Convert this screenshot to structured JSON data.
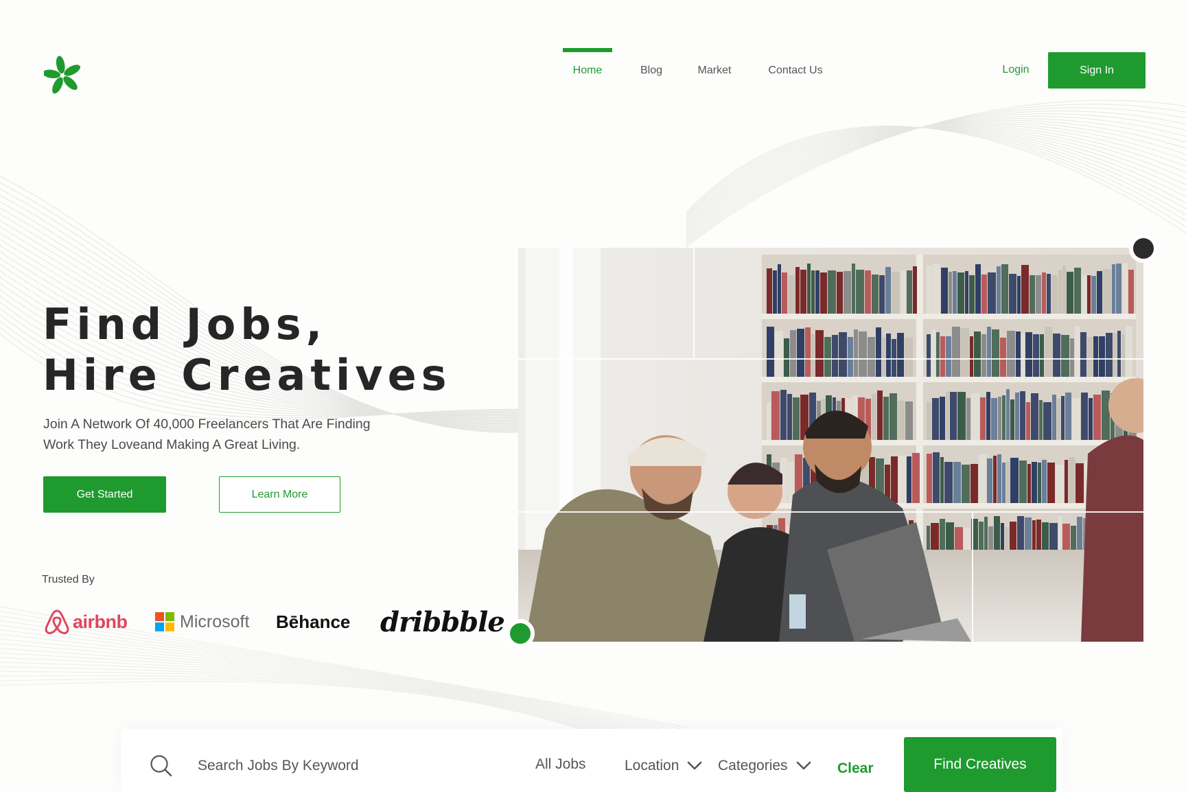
{
  "colors": {
    "accent": "#1f9a2f",
    "text_dark": "#262626",
    "text_muted": "#555555",
    "background": "#fdfdfc"
  },
  "header": {
    "logo_icon": "clover-logo-icon",
    "nav": [
      {
        "label": "Home",
        "active": true
      },
      {
        "label": "Blog",
        "active": false
      },
      {
        "label": "Market",
        "active": false
      },
      {
        "label": "Contact Us",
        "active": false
      }
    ],
    "login_label": "Login",
    "signin_label": "Sign In"
  },
  "hero": {
    "title_line1": "Find Jobs,",
    "title_line2": "Hire Creatives",
    "subtitle": "Join A Network Of 40,000 Freelancers That Are Finding Work They Loveand Making A Great Living.",
    "primary_button": "Get Started",
    "secondary_button": "Learn More",
    "trusted_by_label": "Trusted By",
    "brands": [
      "airbnb",
      "Microsoft",
      "Bēhance",
      "dribbble"
    ],
    "image": "team-laughing-at-laptops-in-library-photo"
  },
  "search": {
    "icon": "search-icon",
    "placeholder": "Search Jobs By Keyword",
    "job_type": "All Jobs",
    "location_label": "Location",
    "categories_label": "Categories",
    "clear_label": "Clear",
    "submit_label": "Find Creatives"
  }
}
